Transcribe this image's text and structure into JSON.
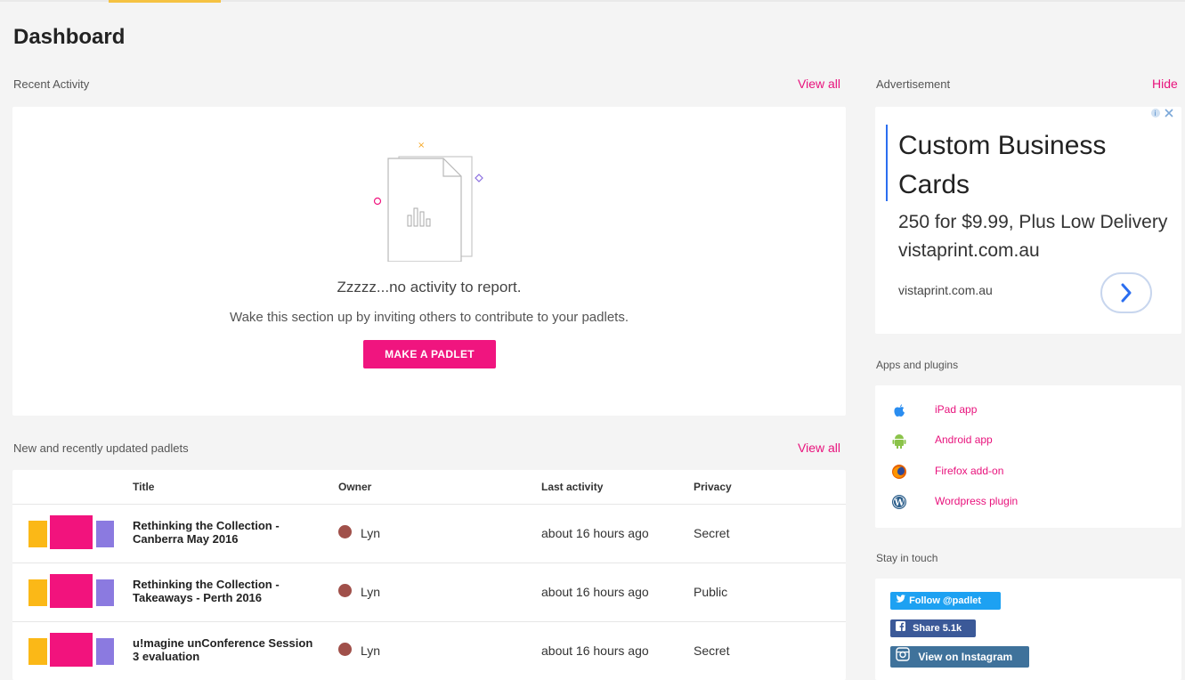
{
  "page": {
    "title": "Dashboard"
  },
  "recent": {
    "label": "Recent Activity",
    "view_all": "View all",
    "empty_title": "Zzzzz...no activity to report.",
    "empty_sub": "Wake this section up by inviting others to contribute to your padlets.",
    "button": "MAKE A PADLET"
  },
  "padlets": {
    "label": "New and recently updated padlets",
    "view_all": "View all",
    "headers": {
      "title": "Title",
      "owner": "Owner",
      "last": "Last activity",
      "privacy": "Privacy"
    },
    "rows": [
      {
        "title": "Rethinking the Collection - Canberra May 2016",
        "owner": "Lyn",
        "last": "about 16 hours ago",
        "privacy": "Secret"
      },
      {
        "title": "Rethinking the Collection - Takeaways - Perth 2016",
        "owner": "Lyn",
        "last": "about 16 hours ago",
        "privacy": "Public"
      },
      {
        "title": "u!magine unConference Session 3 evaluation",
        "owner": "Lyn",
        "last": "about 16 hours ago",
        "privacy": "Secret"
      }
    ]
  },
  "ad": {
    "label": "Advertisement",
    "hide": "Hide",
    "headline": "Custom Business Cards",
    "body": "250 for $9.99, Plus Low Delivery vistaprint.com.au",
    "domain": "vistaprint.com.au"
  },
  "apps": {
    "label": "Apps and plugins",
    "items": [
      {
        "label": "iPad app",
        "icon": "apple-icon"
      },
      {
        "label": "Android app",
        "icon": "android-icon"
      },
      {
        "label": "Firefox add-on",
        "icon": "firefox-icon"
      },
      {
        "label": "Wordpress plugin",
        "icon": "wordpress-icon"
      }
    ]
  },
  "touch": {
    "label": "Stay in touch",
    "twitter": "Follow @padlet",
    "facebook": "Share 5.1k",
    "instagram": "View on Instagram"
  },
  "colors": {
    "accent": "#f0157f",
    "link": "#e8127c",
    "tab": "#f5c242"
  }
}
